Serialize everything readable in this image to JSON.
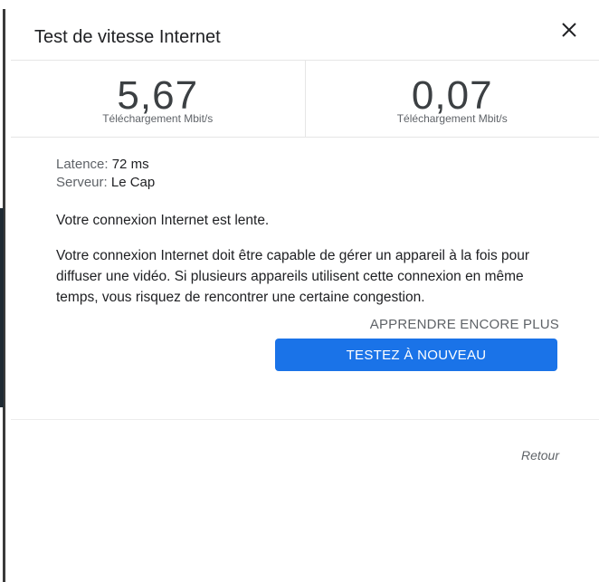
{
  "dialog": {
    "title": "Test de vitesse Internet",
    "close_icon": "close-icon"
  },
  "metrics": [
    {
      "value": "5,67",
      "unit": "Téléchargement Mbit/s"
    },
    {
      "value": "0,07",
      "unit": "Téléchargement Mbit/s"
    }
  ],
  "details": {
    "latency_label": "Latence:",
    "latency_value": "72 ms",
    "server_label": "Serveur:",
    "server_value": "Le Cap",
    "status": "Votre connexion Internet est lente.",
    "description": "Votre connexion Internet doit être capable de gérer un appareil à la fois pour diffuser une vidéo. Si plusieurs appareils utilisent cette connexion en même temps, vous risquez de rencontrer une certaine congestion."
  },
  "actions": {
    "learn_more": "APPRENDRE ENCORE PLUS",
    "retest": "TESTEZ À NOUVEAU",
    "back": "Retour"
  },
  "colors": {
    "accent": "#1a73e8",
    "text": "#202124",
    "muted": "#5f6368"
  }
}
